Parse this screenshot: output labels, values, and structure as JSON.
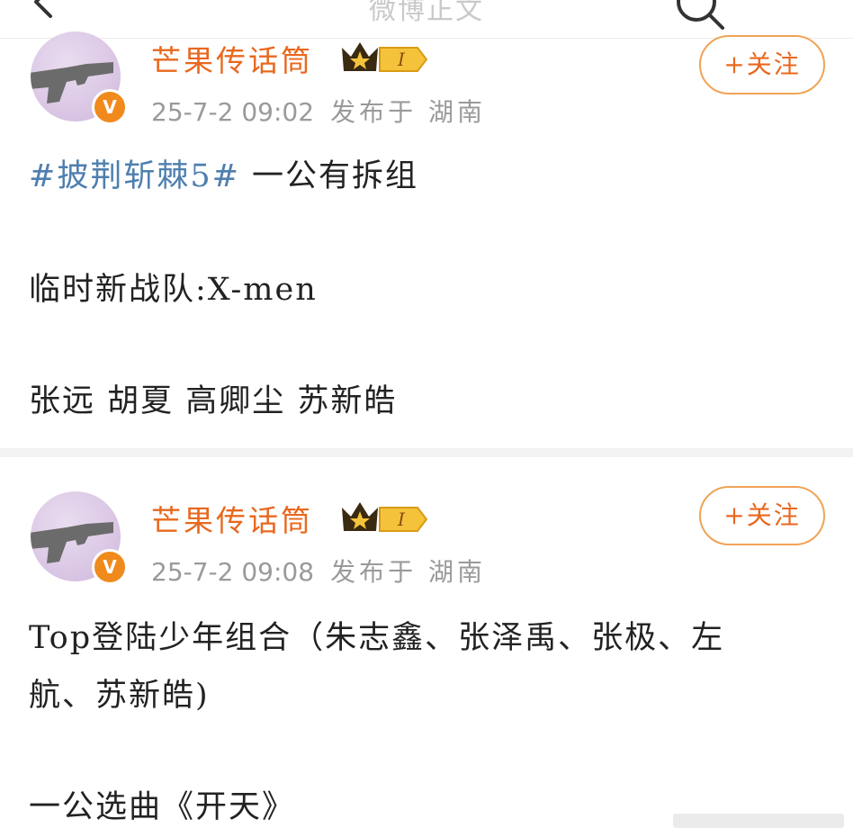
{
  "header": {
    "title": "微博正文"
  },
  "posts": [
    {
      "username": "芒果传话筒",
      "level_badge": "I",
      "time": "25-7-2 09:02",
      "location": "发布于 湖南",
      "follow_label": "+关注",
      "hashtag": "#披荆斩棘5#",
      "line1_rest": " 一公有拆组",
      "line2": "临时新战队:X-men",
      "line3": "张远 胡夏 高卿尘 苏新皓"
    },
    {
      "username": "芒果传话筒",
      "level_badge": "I",
      "time": "25-7-2 09:08",
      "location": "发布于 湖南",
      "follow_label": "+关注",
      "line1": "Top登陆少年组合（朱志鑫、张泽禹、张极、左",
      "line2": "航、苏新皓)",
      "line3": "一公选曲《开天》"
    }
  ],
  "colors": {
    "username": "#e8681e",
    "hashtag": "#4f7fae",
    "meta": "#9a9a9a",
    "follow_border": "#f0a356",
    "verified_badge": "#f08a1c"
  },
  "icons": {
    "back": "chevron-left-icon",
    "search": "search-icon",
    "verified": "verified-v-icon",
    "crown": "crown-level-icon"
  }
}
